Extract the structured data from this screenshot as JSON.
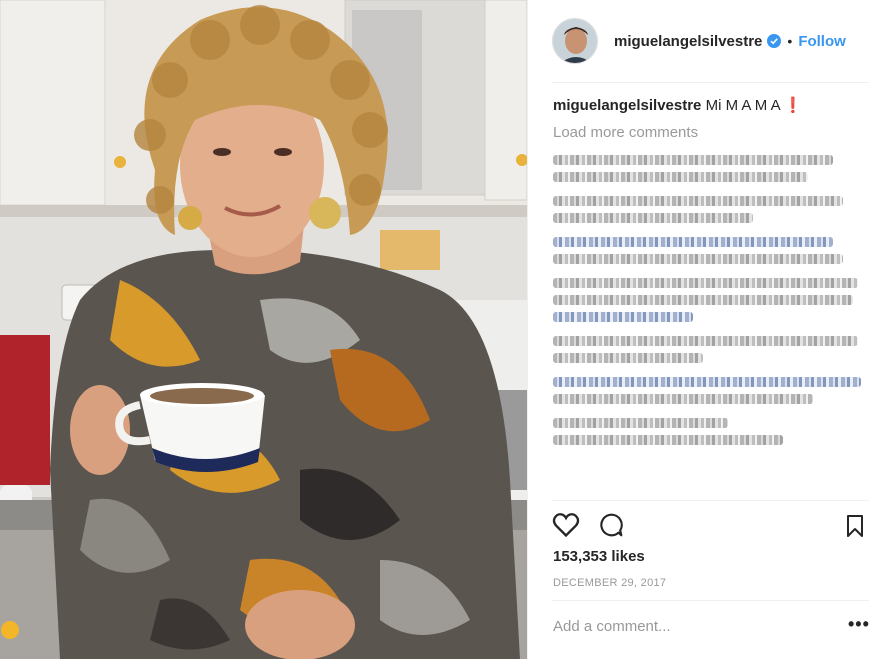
{
  "post": {
    "username": "miguelangelsilvestre",
    "follow_label": "Follow",
    "dot_separator": "•",
    "caption_user": "miguelangelsilvestre",
    "caption_text": "Mi M A M A ❗",
    "load_more": "Load more comments",
    "likes": "153,353 likes",
    "date": "DECEMBER 29, 2017",
    "add_comment_placeholder": "Add a comment...",
    "more_options": "•••"
  },
  "icons": [
    "verified-badge-icon",
    "heart-icon",
    "comment-icon",
    "bookmark-icon",
    "more-options-icon"
  ],
  "colors": {
    "accent": "#3897f0",
    "text": "#262626",
    "muted": "#999999"
  }
}
